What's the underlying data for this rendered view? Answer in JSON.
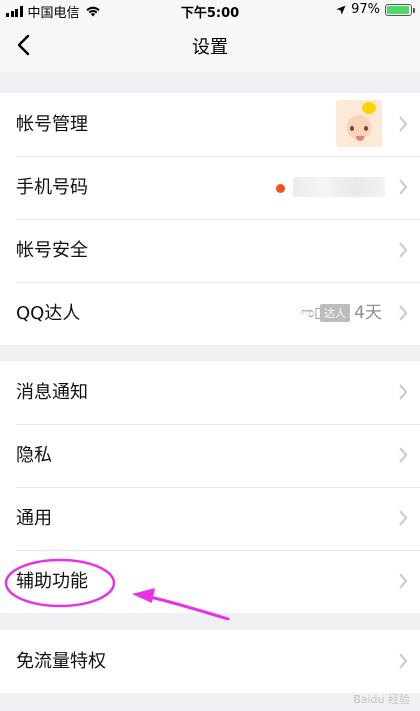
{
  "status_bar": {
    "carrier": "中国电信",
    "time": "下午5:00",
    "battery": "97%",
    "battery_level": 0.97
  },
  "nav": {
    "title": "设置",
    "back_icon": "chevron-left-icon"
  },
  "groups": [
    {
      "items": [
        {
          "label": "帐号管理"
        },
        {
          "label": "手机号码"
        },
        {
          "label": "帐号安全"
        },
        {
          "label": "QQ达人",
          "badge": "达人",
          "value": "4天"
        }
      ]
    },
    {
      "items": [
        {
          "label": "消息通知"
        },
        {
          "label": "隐私"
        },
        {
          "label": "通用"
        },
        {
          "label": "辅助功能"
        }
      ]
    },
    {
      "items": [
        {
          "label": "免流量特权"
        }
      ]
    }
  ],
  "colors": {
    "background": "#efeff4",
    "annotation": "#e832e8",
    "red_dot": "#f4511e",
    "battery": "#4cd964"
  },
  "watermark": "Baidu 经验"
}
